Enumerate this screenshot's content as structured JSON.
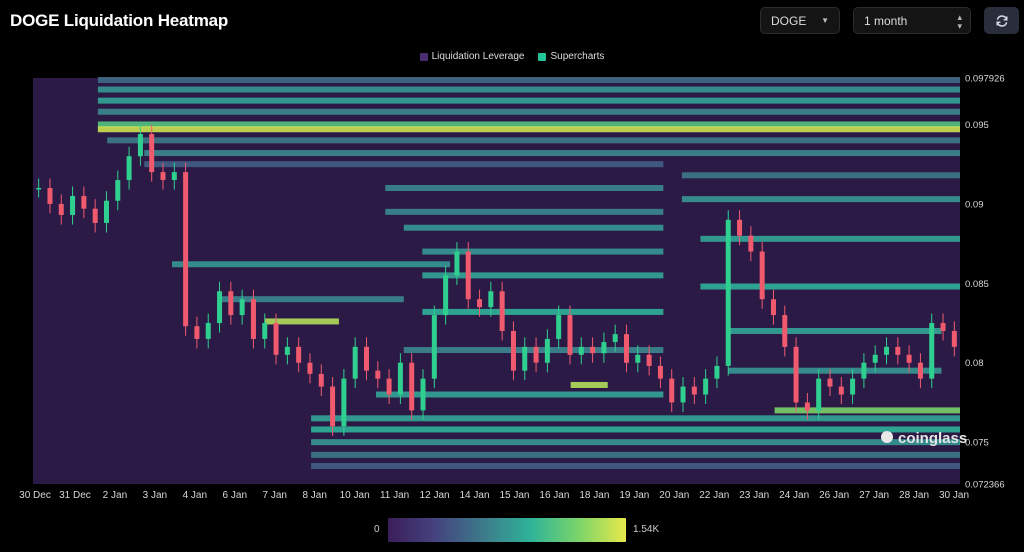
{
  "header": {
    "title": "DOGE Liquidation Heatmap",
    "symbol": "DOGE",
    "range": "1 month"
  },
  "legend": [
    {
      "label": "Liquidation Leverage",
      "color": "#4b2c6e"
    },
    {
      "label": "Supercharts",
      "color": "#22c59a"
    }
  ],
  "watermark": "coinglass",
  "colorbar": {
    "min_label": "0",
    "max_label": "1.54K",
    "colors": [
      "#3b1e5a",
      "#44437f",
      "#3d7a8a",
      "#2fb39a",
      "#7ad46a",
      "#e8e84a"
    ]
  },
  "chart_data": {
    "type": "heatmap",
    "x_ticks": [
      "30 Dec",
      "31 Dec",
      "2 Jan",
      "3 Jan",
      "4 Jan",
      "6 Jan",
      "7 Jan",
      "8 Jan",
      "10 Jan",
      "11 Jan",
      "12 Jan",
      "14 Jan",
      "15 Jan",
      "16 Jan",
      "18 Jan",
      "19 Jan",
      "20 Jan",
      "22 Jan",
      "23 Jan",
      "24 Jan",
      "26 Jan",
      "27 Jan",
      "28 Jan",
      "30 Jan"
    ],
    "y_ticks": [
      0.097926,
      0.095,
      0.09,
      0.085,
      0.08,
      0.075,
      0.072366
    ],
    "y_tick_labels": [
      "0.097926",
      "0.095",
      "0.09",
      "0.085",
      "0.08",
      "0.075",
      "0.072366"
    ],
    "ylim": [
      0.072366,
      0.097926
    ],
    "price_series": [
      0.091,
      0.09,
      0.0893,
      0.0905,
      0.0897,
      0.0888,
      0.0902,
      0.0915,
      0.093,
      0.0944,
      0.092,
      0.0915,
      0.092,
      0.0823,
      0.0815,
      0.0825,
      0.0845,
      0.083,
      0.084,
      0.0815,
      0.0825,
      0.0805,
      0.081,
      0.08,
      0.0793,
      0.0785,
      0.076,
      0.079,
      0.081,
      0.0795,
      0.079,
      0.078,
      0.08,
      0.077,
      0.079,
      0.083,
      0.0855,
      0.087,
      0.084,
      0.0835,
      0.0845,
      0.082,
      0.0795,
      0.081,
      0.08,
      0.0815,
      0.083,
      0.0805,
      0.081,
      0.0806,
      0.0813,
      0.0818,
      0.08,
      0.0805,
      0.0798,
      0.079,
      0.0775,
      0.0785,
      0.078,
      0.079,
      0.0798,
      0.089,
      0.088,
      0.087,
      0.084,
      0.083,
      0.081,
      0.0775,
      0.077,
      0.079,
      0.0785,
      0.078,
      0.079,
      0.08,
      0.0805,
      0.081,
      0.0805,
      0.08,
      0.079,
      0.0825,
      0.082,
      0.081
    ],
    "liquidation_levels": [
      {
        "price": 0.0978,
        "x_from": 0.07,
        "x_to": 1.0,
        "intensity": 0.35
      },
      {
        "price": 0.0972,
        "x_from": 0.07,
        "x_to": 1.0,
        "intensity": 0.5
      },
      {
        "price": 0.0965,
        "x_from": 0.07,
        "x_to": 1.0,
        "intensity": 0.55
      },
      {
        "price": 0.0958,
        "x_from": 0.07,
        "x_to": 1.0,
        "intensity": 0.45
      },
      {
        "price": 0.095,
        "x_from": 0.07,
        "x_to": 1.0,
        "intensity": 0.7
      },
      {
        "price": 0.0947,
        "x_from": 0.07,
        "x_to": 1.0,
        "intensity": 0.95
      },
      {
        "price": 0.094,
        "x_from": 0.08,
        "x_to": 1.0,
        "intensity": 0.4
      },
      {
        "price": 0.0932,
        "x_from": 0.12,
        "x_to": 1.0,
        "intensity": 0.45
      },
      {
        "price": 0.0925,
        "x_from": 0.12,
        "x_to": 0.68,
        "intensity": 0.3
      },
      {
        "price": 0.0918,
        "x_from": 0.7,
        "x_to": 1.0,
        "intensity": 0.4
      },
      {
        "price": 0.091,
        "x_from": 0.38,
        "x_to": 0.68,
        "intensity": 0.45
      },
      {
        "price": 0.0903,
        "x_from": 0.7,
        "x_to": 1.0,
        "intensity": 0.5
      },
      {
        "price": 0.0895,
        "x_from": 0.38,
        "x_to": 0.68,
        "intensity": 0.45
      },
      {
        "price": 0.0885,
        "x_from": 0.4,
        "x_to": 0.68,
        "intensity": 0.5
      },
      {
        "price": 0.0878,
        "x_from": 0.72,
        "x_to": 1.0,
        "intensity": 0.55
      },
      {
        "price": 0.087,
        "x_from": 0.42,
        "x_to": 0.68,
        "intensity": 0.5
      },
      {
        "price": 0.0862,
        "x_from": 0.15,
        "x_to": 0.45,
        "intensity": 0.5
      },
      {
        "price": 0.0855,
        "x_from": 0.42,
        "x_to": 0.68,
        "intensity": 0.55
      },
      {
        "price": 0.0848,
        "x_from": 0.72,
        "x_to": 1.0,
        "intensity": 0.6
      },
      {
        "price": 0.084,
        "x_from": 0.2,
        "x_to": 0.4,
        "intensity": 0.45
      },
      {
        "price": 0.0832,
        "x_from": 0.42,
        "x_to": 0.68,
        "intensity": 0.6
      },
      {
        "price": 0.0826,
        "x_from": 0.25,
        "x_to": 0.33,
        "intensity": 0.9
      },
      {
        "price": 0.082,
        "x_from": 0.75,
        "x_to": 0.98,
        "intensity": 0.55
      },
      {
        "price": 0.0808,
        "x_from": 0.4,
        "x_to": 0.68,
        "intensity": 0.45
      },
      {
        "price": 0.0795,
        "x_from": 0.75,
        "x_to": 0.98,
        "intensity": 0.5
      },
      {
        "price": 0.0786,
        "x_from": 0.58,
        "x_to": 0.62,
        "intensity": 0.9
      },
      {
        "price": 0.078,
        "x_from": 0.37,
        "x_to": 0.68,
        "intensity": 0.55
      },
      {
        "price": 0.077,
        "x_from": 0.8,
        "x_to": 1.0,
        "intensity": 0.8
      },
      {
        "price": 0.0765,
        "x_from": 0.3,
        "x_to": 1.0,
        "intensity": 0.55
      },
      {
        "price": 0.0758,
        "x_from": 0.3,
        "x_to": 1.0,
        "intensity": 0.6
      },
      {
        "price": 0.075,
        "x_from": 0.3,
        "x_to": 1.0,
        "intensity": 0.5
      },
      {
        "price": 0.0742,
        "x_from": 0.3,
        "x_to": 1.0,
        "intensity": 0.4
      },
      {
        "price": 0.0735,
        "x_from": 0.3,
        "x_to": 1.0,
        "intensity": 0.3
      }
    ]
  }
}
